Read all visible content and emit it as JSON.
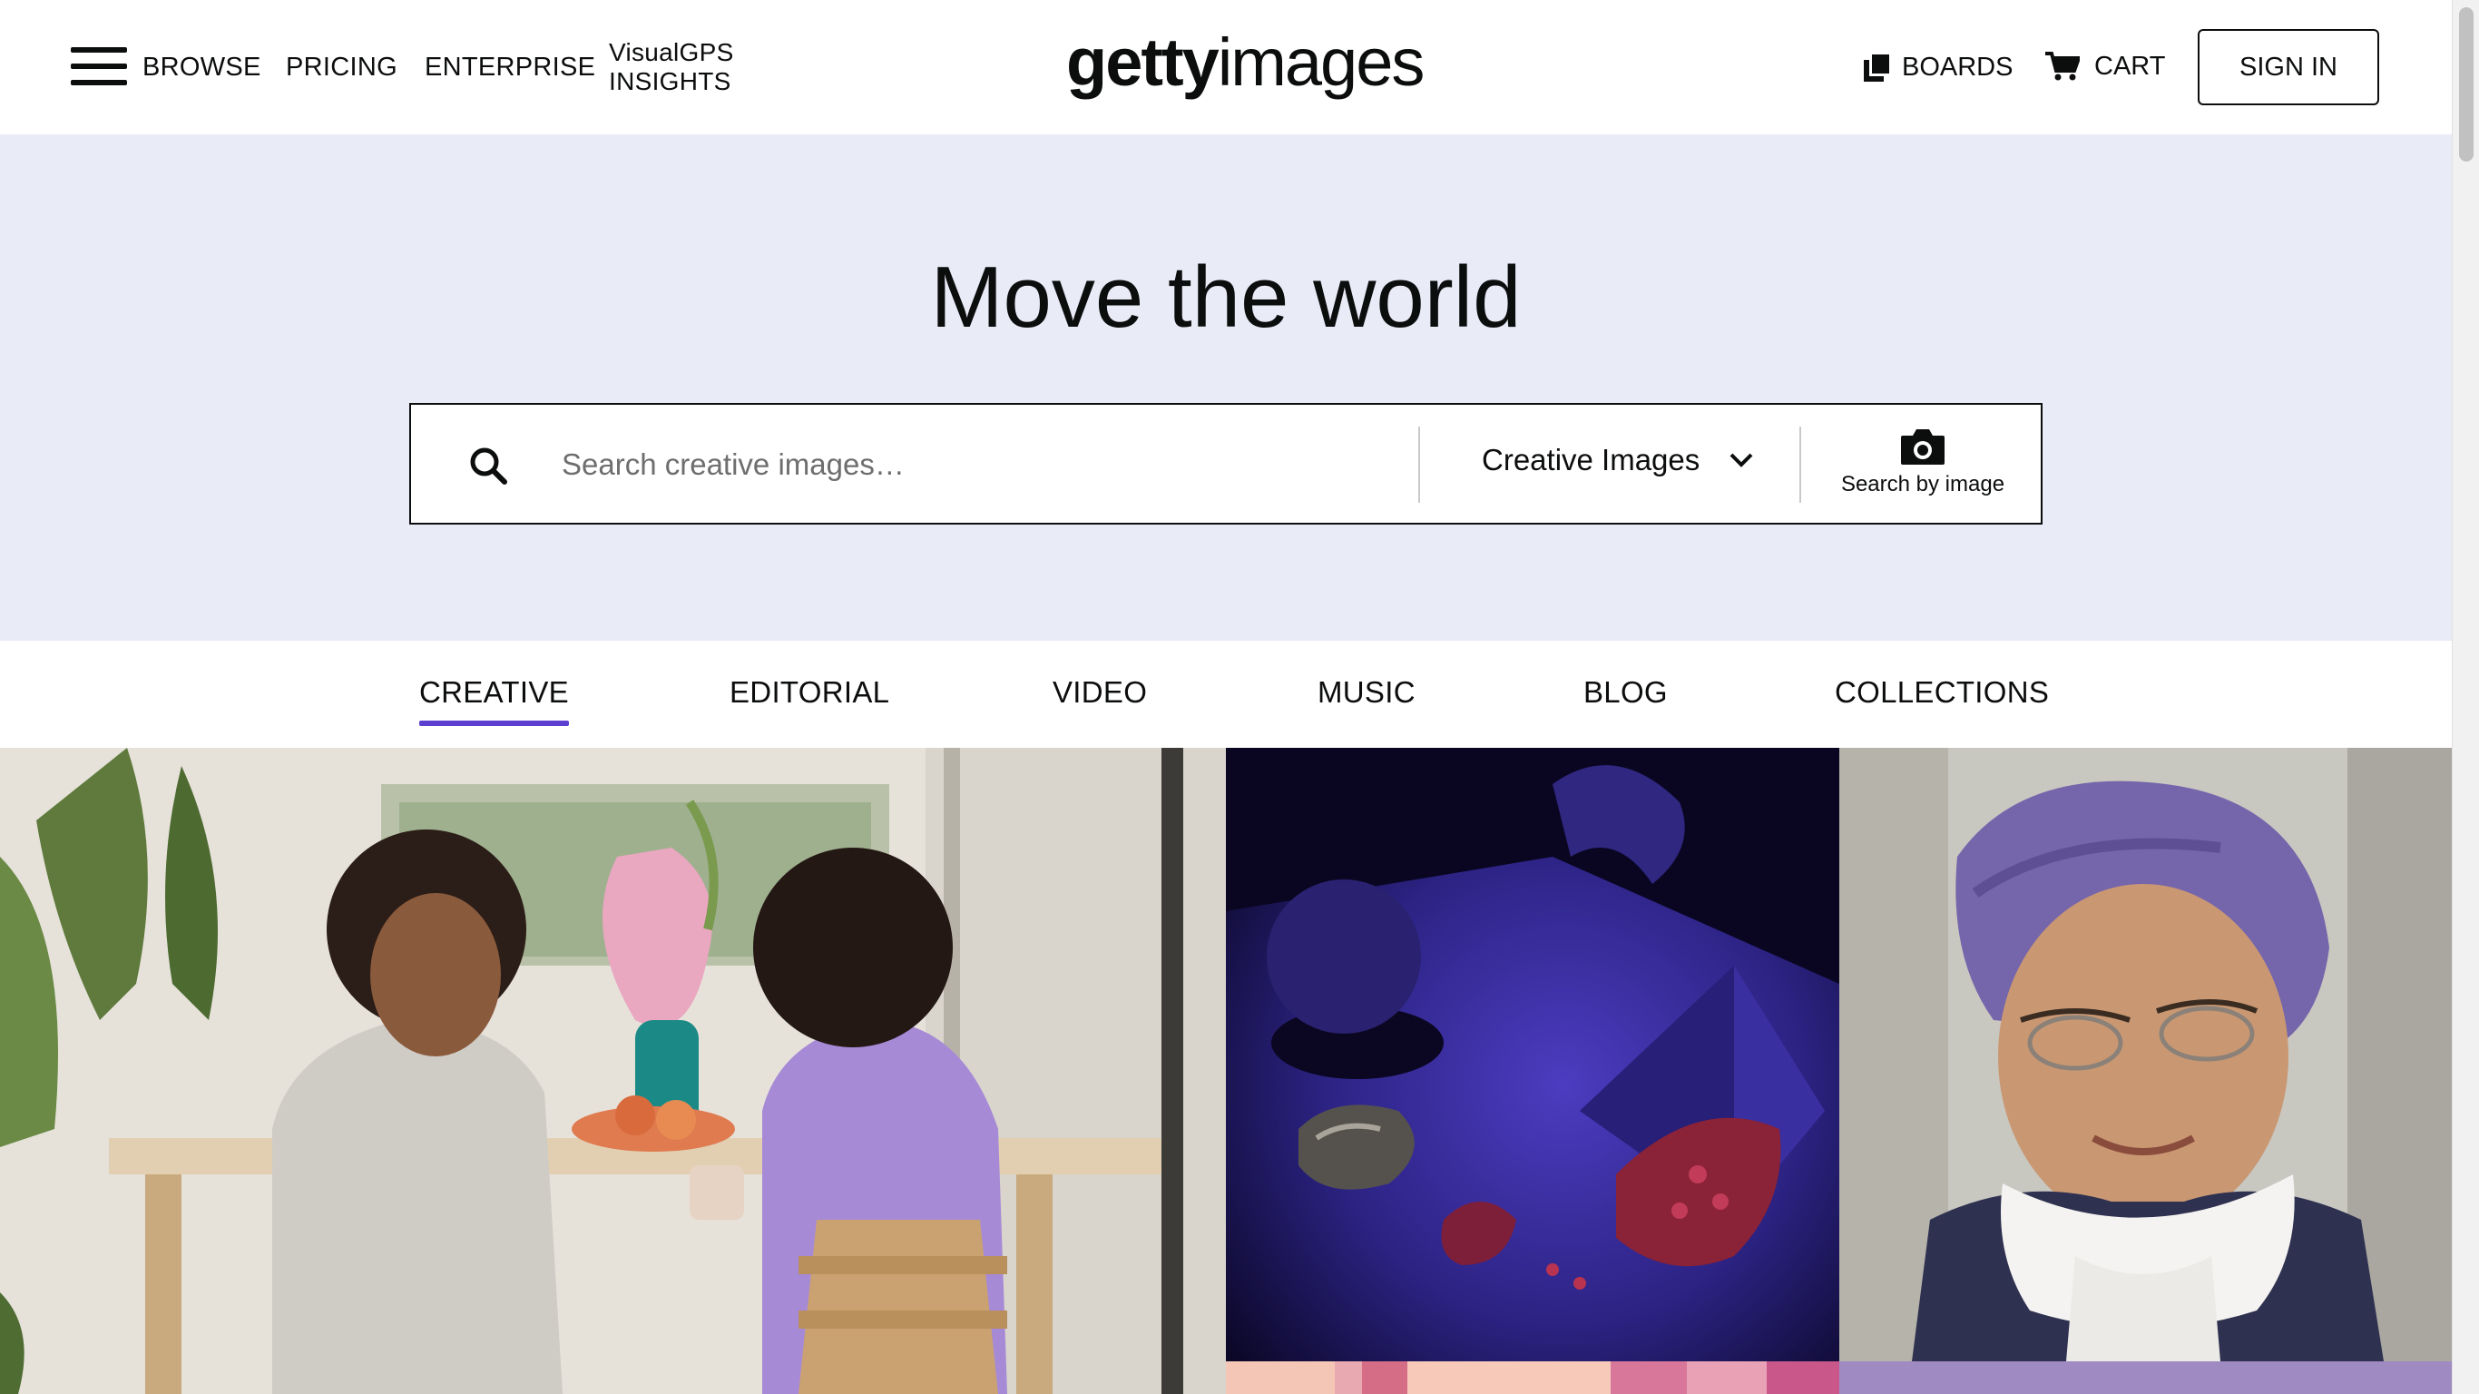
{
  "header": {
    "nav": {
      "browse": "BROWSE",
      "pricing": "PRICING",
      "enterprise": "ENTERPRISE",
      "insights_line1": "VisualGPS",
      "insights_line2": "INSIGHTS"
    },
    "logo": {
      "bold": "getty",
      "light": "images"
    },
    "boards_label": "BOARDS",
    "cart_label": "CART",
    "signin_label": "SIGN IN"
  },
  "hero": {
    "title": "Move the world",
    "search": {
      "placeholder": "Search creative images…",
      "value": "",
      "type_selected": "Creative Images",
      "search_by_image_label": "Search by image"
    }
  },
  "tabs": [
    {
      "label": "CREATIVE",
      "active": true
    },
    {
      "label": "EDITORIAL",
      "active": false
    },
    {
      "label": "VIDEO",
      "active": false
    },
    {
      "label": "MUSIC",
      "active": false
    },
    {
      "label": "BLOG",
      "active": false
    },
    {
      "label": "COLLECTIONS",
      "active": false
    }
  ],
  "colors": {
    "hero_bg": "#e9ebf7",
    "accent_underline": "#5b3fcf",
    "text": "#0c0d0d"
  },
  "icons": [
    "menu-icon",
    "boards-icon",
    "cart-icon",
    "search-icon",
    "chevron-down-icon",
    "camera-icon"
  ]
}
